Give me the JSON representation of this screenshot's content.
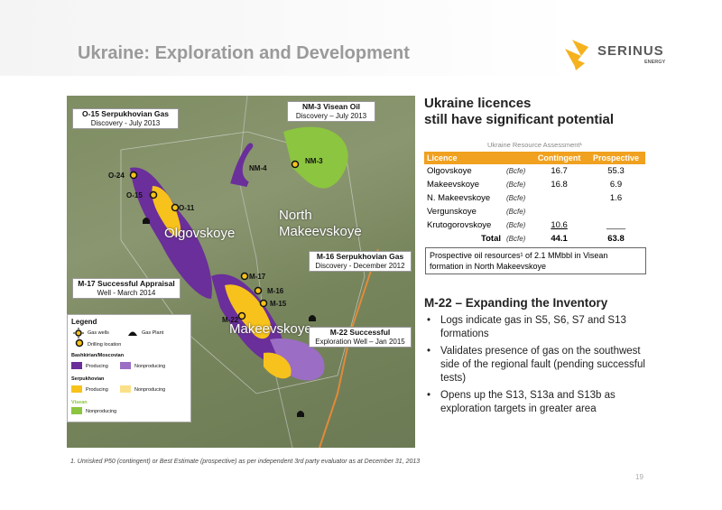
{
  "slide": {
    "title": "Ukraine:  Exploration and Development",
    "page_number": "19"
  },
  "logo": {
    "name": "SERINUS",
    "sub": "ENERGY",
    "brand_color": "#f5b21e"
  },
  "map": {
    "callouts": {
      "o15": {
        "title": "O-15  Serpukhovian Gas",
        "sub": "Discovery - July 2013"
      },
      "nm3": {
        "title": "NM-3 Visean Oil",
        "sub": "Discovery – July 2013"
      },
      "m16": {
        "title": "M-16  Serpukhovian Gas",
        "sub": "Discovery - December 2012"
      },
      "m17": {
        "title": "M-17  Successful Appraisal",
        "sub": "Well - March 2014"
      },
      "m22": {
        "title": "M-22  Successful",
        "sub": "Exploration Well – Jan 2015"
      }
    },
    "areas": {
      "north1": "North",
      "north2": "Makeevskoye",
      "olgovskoye": "Olgovskoye",
      "makeevskoye": "Makeevskoye"
    },
    "wells": {
      "o24": "O-24",
      "o15": "O-15",
      "o11": "O-11",
      "nm4": "NM-4",
      "nm3": "NM-3",
      "m17": "M-17",
      "m16": "M-16",
      "m15": "M-15",
      "m22": "M-22"
    },
    "colors": {
      "producing_purple": "#6a2f9a",
      "nonproducing_purple": "#9b6dc4",
      "serpukhovian": "#f7c21b",
      "visean": "#8cc540"
    }
  },
  "legend": {
    "title": "Legend",
    "gas_wells": "Gas wells",
    "gas_plant": "Gas Plant",
    "drilling_location": "Drilling location",
    "bashkirian": "Bashkirian/Moscovian",
    "serpukhovian": "Serpukhovian",
    "visean": "Visean",
    "producing": "Producing",
    "nonproducing": "Nonproducing"
  },
  "heading": {
    "line1": "Ukraine licences",
    "line2": "still have significant potential"
  },
  "resource_table": {
    "title": "Ukraine Resource Assessment¹",
    "headers": {
      "licence": "Licence",
      "contingent": "Contingent",
      "prospective": "Prospective"
    },
    "rows": [
      {
        "licence": "Olgovskoye",
        "unit": "(Bcfe)",
        "contingent": "16.7",
        "prospective": "55.3"
      },
      {
        "licence": "Makeevskoye",
        "unit": "(Bcfe)",
        "contingent": "16.8",
        "prospective": "6.9"
      },
      {
        "licence": "N. Makeevskoye",
        "unit": "(Bcfe)",
        "contingent": "",
        "prospective": "1.6"
      },
      {
        "licence": "Vergunskoye",
        "unit": "(Bcfe)",
        "contingent": "",
        "prospective": ""
      },
      {
        "licence": "Krutogorovskoye",
        "unit": "(Bcfe)",
        "contingent": "10.6",
        "prospective": "____"
      }
    ],
    "total": {
      "label": "Total",
      "unit": "(Bcfe)",
      "contingent": "44.1",
      "prospective": "63.8"
    },
    "note": "Prospective oil resources¹ of 2.1 MMbbl in Visean formation in North Makeevskoye"
  },
  "m22": {
    "heading": "M-22 – Expanding the Inventory",
    "bullets": [
      "Logs indicate gas in S5, S6, S7 and S13 formations",
      "Validates presence of gas on the southwest side of the regional fault (pending successful tests)",
      "Opens up the S13, S13a and S13b as exploration targets in greater area"
    ]
  },
  "footnote": "1.      Unrisked P50 (contingent) or Best Estimate (prospective) as per independent 3rd party evaluator as at December 31, 2013"
}
